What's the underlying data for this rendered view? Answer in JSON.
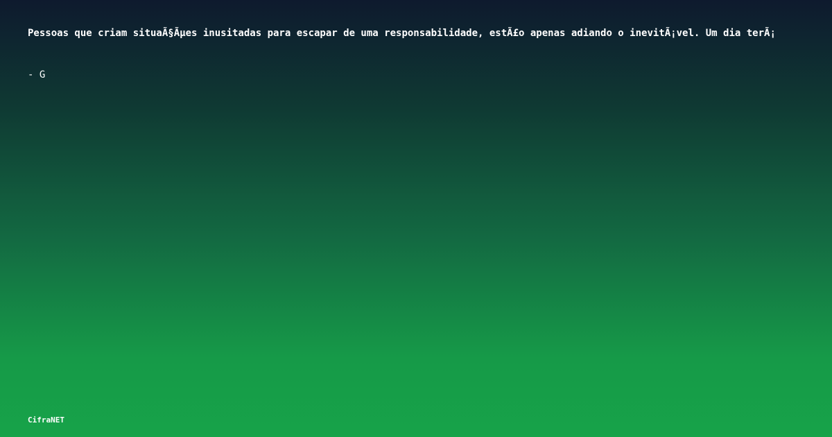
{
  "quote": {
    "text": "Pessoas que criam situaÃ§Ãµes inusitadas para escapar de uma responsabilidade, estÃ£o apenas adiando o inevitÃ¡vel. Um dia terÃ¡"
  },
  "author": {
    "text": "- G"
  },
  "brand": {
    "name": "CifraNET"
  },
  "colors": {
    "gradient_top": "#0e1a2e",
    "gradient_bottom": "#17a349",
    "text": "#ffffff"
  }
}
